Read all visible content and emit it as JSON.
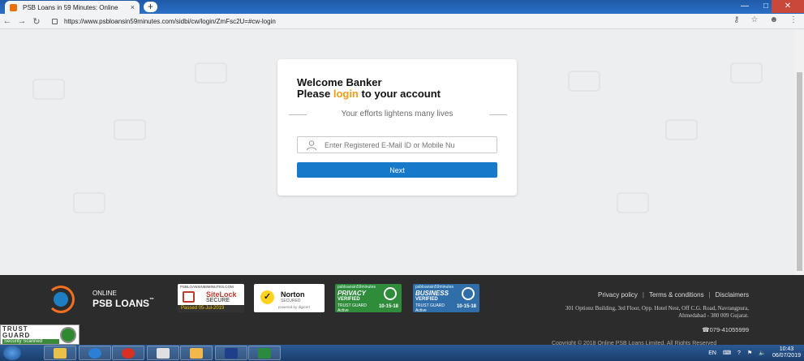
{
  "browser": {
    "tab_title": "PSB Loans in 59 Minutes: Online",
    "tab_close": "×",
    "new_tab": "+",
    "url": "https://www.psbloansin59minutes.com/sidbi/cw/login/ZmFsc2U=#cw-login",
    "back_icon": "←",
    "forward_icon": "→",
    "reload_icon": "↻"
  },
  "login_card": {
    "welcome": "Welcome Banker",
    "please_prefix": "Please ",
    "login_word": "login",
    "please_suffix": " to your account",
    "tagline": "Your efforts lightens many lives",
    "input_placeholder": "Enter Registered E-Mail ID or Mobile Nu",
    "next_label": "Next",
    "login_color": "#f39c12",
    "button_color": "#1779c9"
  },
  "footer": {
    "logo_line1": "ONLINE",
    "logo_line2": "PSB LOANS",
    "logo_tm": "™",
    "sitelock": {
      "site": "PSBLOANSIN59MINUTES.COM",
      "name": "SiteLock",
      "secure": "SECURE",
      "passed": "Passed  05-Jul-2019"
    },
    "norton": {
      "name": "Norton",
      "secured": "SECURED",
      "powered": "powered by digicert"
    },
    "privacy_badge": {
      "site": "psbloansin59minutes",
      "title": "PRIVACY",
      "verified": "VERIFIED",
      "trust": "TRUST  GUARD",
      "active": "Active",
      "date": "10-15-18"
    },
    "business_badge": {
      "site": "psbloansin59minutes",
      "title": "BUSINESS",
      "verified": "VERIFIED",
      "trust": "TRUST  GUARD",
      "active": "Active",
      "date": "10-15-18"
    },
    "links": [
      "Privacy policy",
      "Terms & conditions",
      "Disclaimers"
    ],
    "separator": "|",
    "address": "301 Optionz Building, 3rd Floor, Opp. Hotel Nest, Off C.G. Road, Navrangpura, Ahmedabad - 380 009 Gujarat.",
    "phone": "☎079-41055999",
    "copyright": "Copyright © 2018 Online PSB Loans Limited. All Rights Reserved"
  },
  "trustguard_seal": {
    "line1": "TRUST",
    "line2": "GUARD",
    "scanned": "Security Scanned"
  },
  "taskbar": {
    "lang": "EN",
    "time": "10:43",
    "date": "06/07/2019"
  }
}
